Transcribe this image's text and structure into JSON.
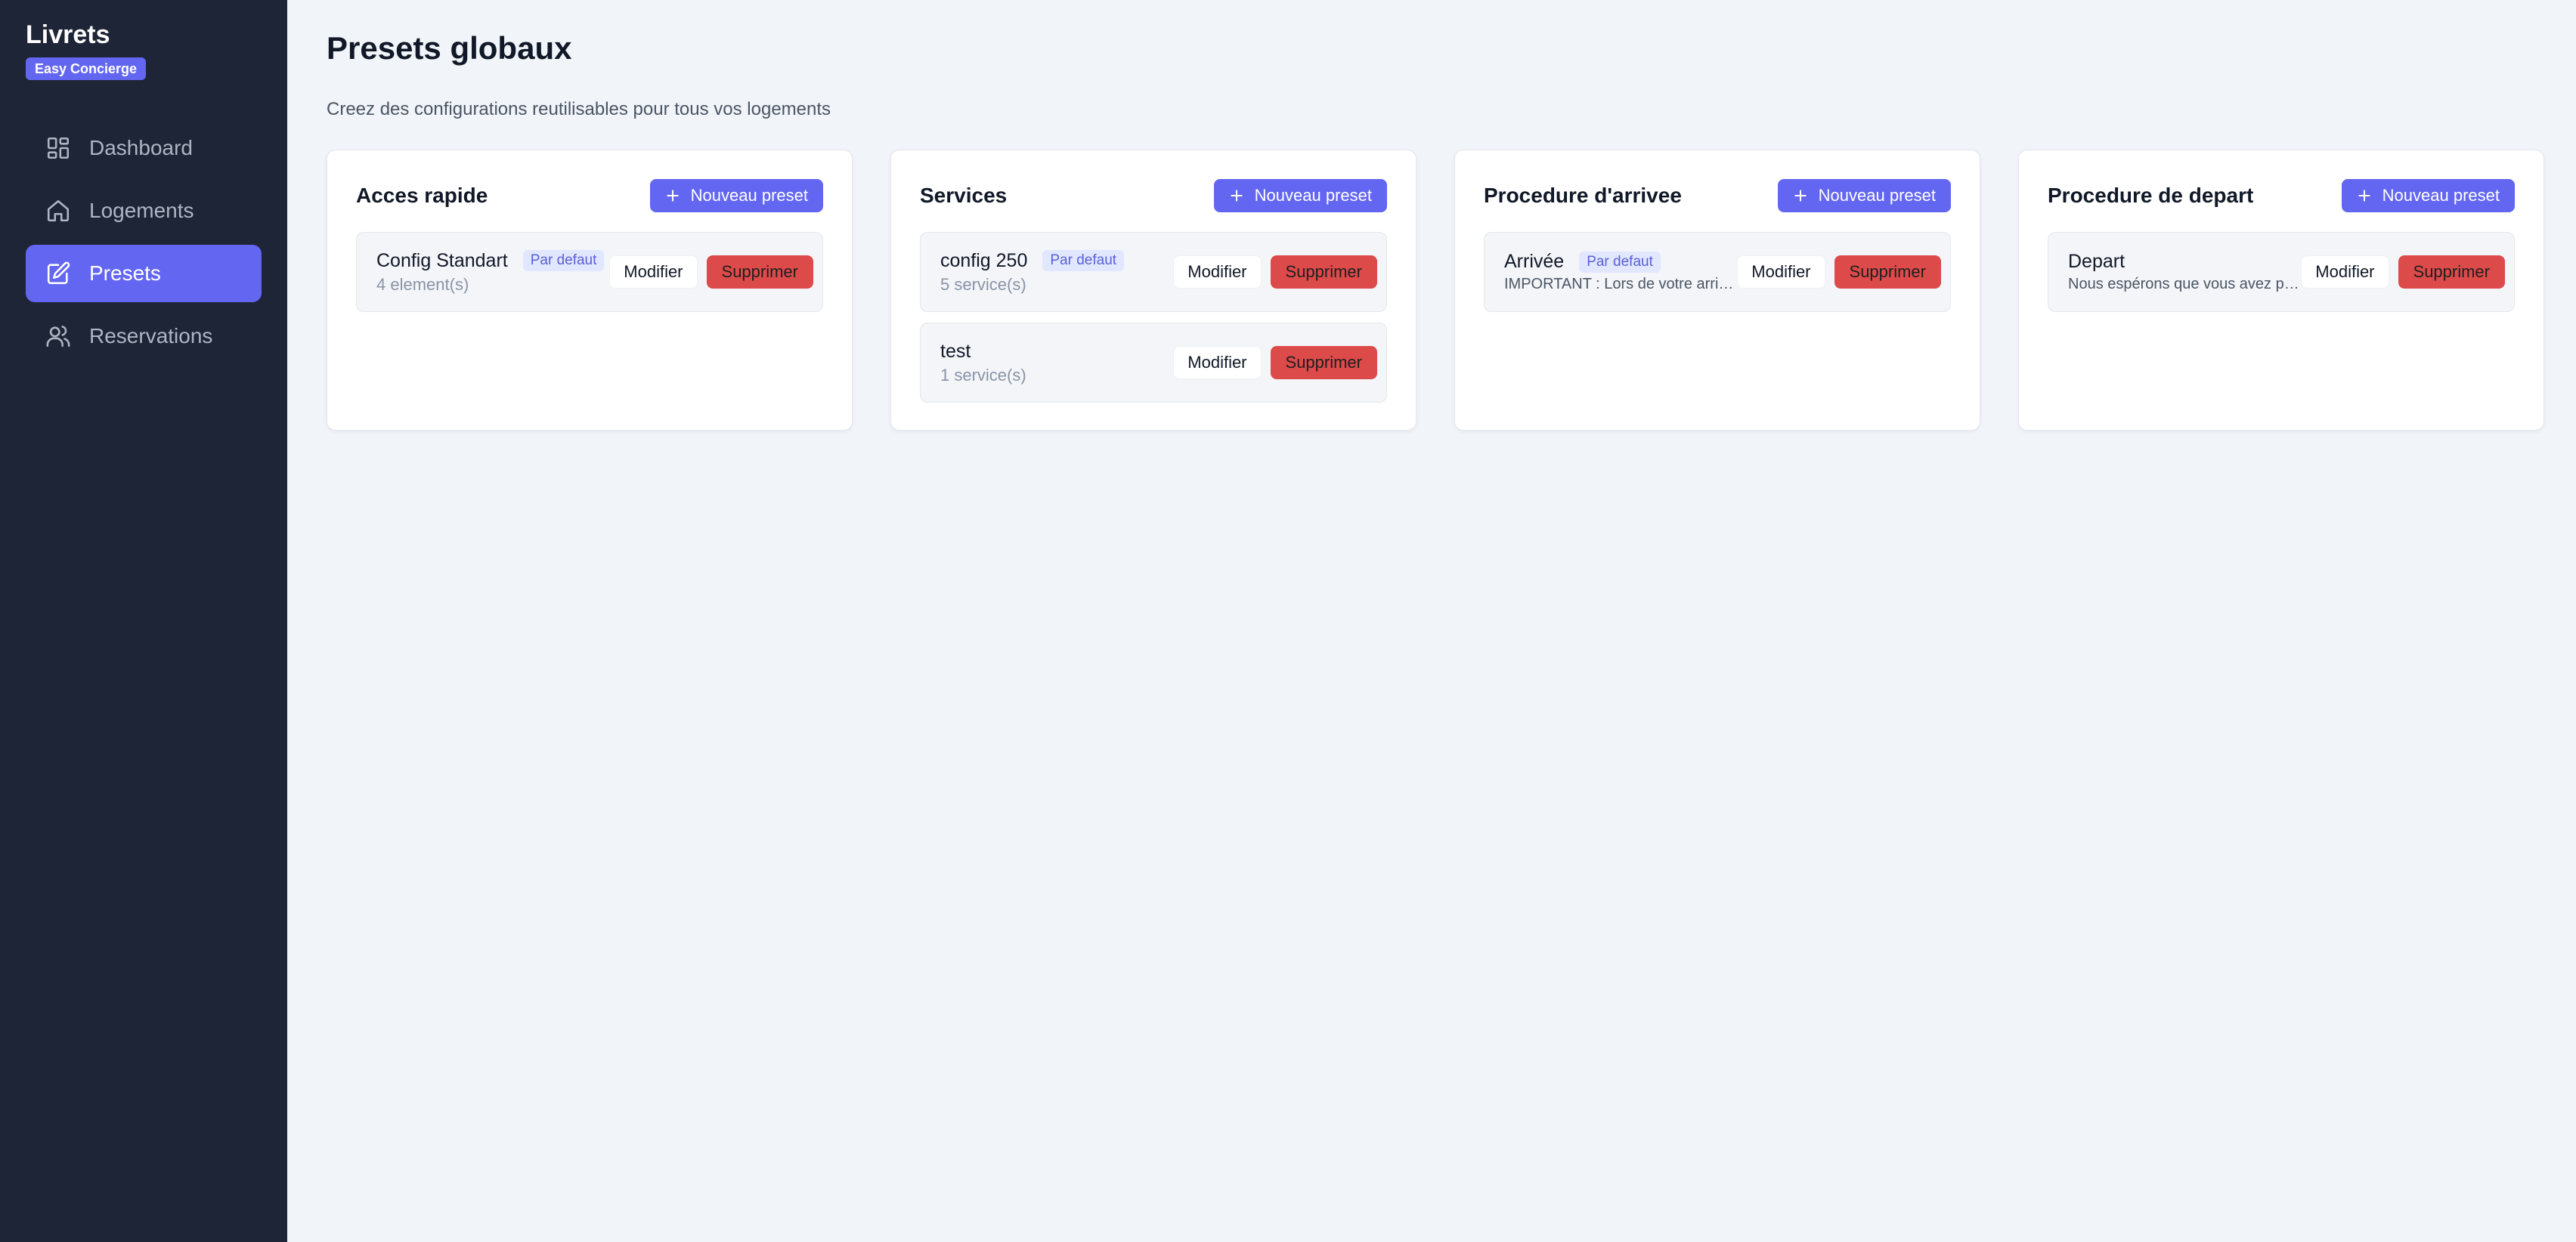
{
  "brand": {
    "title": "Livrets",
    "badge": "Easy Concierge"
  },
  "nav": [
    {
      "label": "Dashboard",
      "icon": "dashboard-icon",
      "active": false
    },
    {
      "label": "Logements",
      "icon": "home-icon",
      "active": false
    },
    {
      "label": "Presets",
      "icon": "edit-icon",
      "active": true
    },
    {
      "label": "Reservations",
      "icon": "users-icon",
      "active": false
    }
  ],
  "page": {
    "title": "Presets globaux",
    "subtitle": "Creez des configurations reutilisables pour tous vos logements"
  },
  "labels": {
    "new_preset": "Nouveau preset",
    "edit": "Modifier",
    "delete": "Supprimer",
    "default_badge": "Par defaut"
  },
  "cards": [
    {
      "title": "Acces rapide",
      "presets": [
        {
          "name": "Config Standart",
          "meta": "4 element(s)",
          "is_default": true
        }
      ]
    },
    {
      "title": "Services",
      "presets": [
        {
          "name": "config 250",
          "meta": "5 service(s)",
          "is_default": true
        },
        {
          "name": "test",
          "meta": "1 service(s)",
          "is_default": false
        }
      ]
    },
    {
      "title": "Procedure d'arrivee",
      "presets": [
        {
          "name": "Arrivée",
          "meta": "IMPORTANT : Lors de votre arrivée...",
          "is_default": true
        }
      ]
    },
    {
      "title": "Procedure de depart",
      "presets": [
        {
          "name": "Depart",
          "meta": "Nous espérons que vous avez passé un agréable séjour...",
          "is_default": false
        }
      ]
    }
  ],
  "colors": {
    "accent": "#6366f1",
    "sidebar_bg": "#1e2536",
    "danger": "#dc4a4a",
    "page_bg": "#f1f4f9"
  }
}
